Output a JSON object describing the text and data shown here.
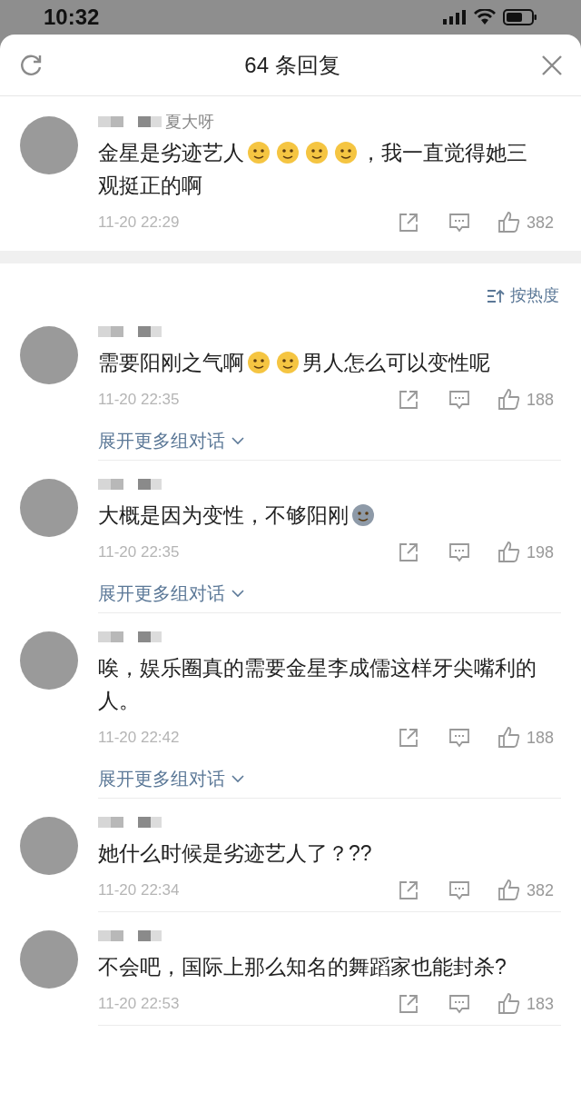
{
  "status_bar": {
    "time": "10:32"
  },
  "header": {
    "title": "64 条回复"
  },
  "top_comment": {
    "author": "夏大呀",
    "segments": [
      {
        "kind": "text",
        "text": "金星是劣迹艺人"
      },
      {
        "kind": "emoji",
        "color": "#f5c542"
      },
      {
        "kind": "emoji",
        "color": "#f5c542"
      },
      {
        "kind": "emoji",
        "color": "#f5c542"
      },
      {
        "kind": "emoji",
        "color": "#f5c542"
      },
      {
        "kind": "text",
        "text": "，我一直觉得她三"
      },
      {
        "kind": "text",
        "text": "观挺正的啊"
      }
    ],
    "time": "11-20 22:29",
    "likes": "382"
  },
  "sort": {
    "label": "按热度"
  },
  "comments": [
    {
      "segments": [
        {
          "kind": "text",
          "text": "需要阳刚之气啊"
        },
        {
          "kind": "emoji",
          "color": "#f5c542"
        },
        {
          "kind": "emoji",
          "color": "#f5c542"
        },
        {
          "kind": "text",
          "text": "男人怎么可以变性呢"
        }
      ],
      "time": "11-20 22:35",
      "likes": "188",
      "expand": "展开更多组对话"
    },
    {
      "segments": [
        {
          "kind": "text",
          "text": "大概是因为变性，不够阳刚"
        },
        {
          "kind": "emoji",
          "color": "#8e9aa8"
        }
      ],
      "time": "11-20 22:35",
      "likes": "198",
      "expand": "展开更多组对话"
    },
    {
      "segments": [
        {
          "kind": "text",
          "text": "唉，娱乐圈真的需要金星李成儒这样牙尖嘴利的"
        },
        {
          "kind": "text",
          "text": "人。"
        }
      ],
      "time": "11-20 22:42",
      "likes": "188",
      "expand": "展开更多组对话"
    },
    {
      "segments": [
        {
          "kind": "text",
          "text": "她什么时候是劣迹艺人了？??"
        }
      ],
      "time": "11-20 22:34",
      "likes": "382"
    },
    {
      "segments": [
        {
          "kind": "text",
          "text": "不会吧，国际上那么知名的舞蹈家也能封杀?"
        }
      ],
      "time": "11-20 22:53",
      "likes": "183"
    }
  ]
}
